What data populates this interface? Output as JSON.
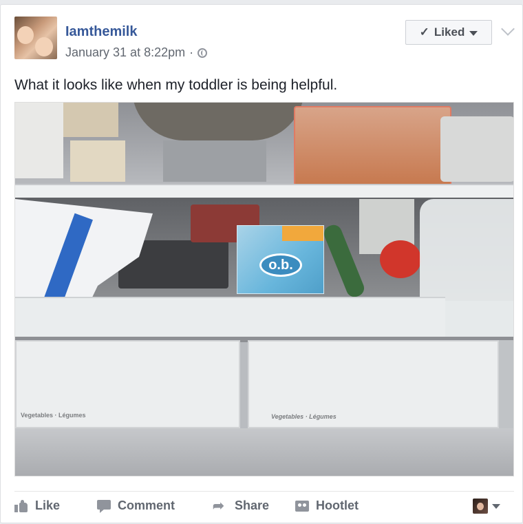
{
  "post": {
    "author": "Iamthemilk",
    "timestamp": "January 31 at 8:22pm",
    "separator": "·",
    "privacy_icon": "globe-icon",
    "liked_label": "Liked",
    "text": "What it looks like when my toddler is being helpful."
  },
  "photo": {
    "tampon_brand": "o.b.",
    "drawer_left_label": "Vegetables · Légumes",
    "drawer_right_label": "Vegetables · Légumes"
  },
  "actions": {
    "like": "Like",
    "comment": "Comment",
    "share": "Share",
    "hootlet": "Hootlet"
  },
  "colors": {
    "author_link": "#365899",
    "action_text": "#616770",
    "card_bg": "#ffffff",
    "page_bg": "#e9ebee"
  }
}
